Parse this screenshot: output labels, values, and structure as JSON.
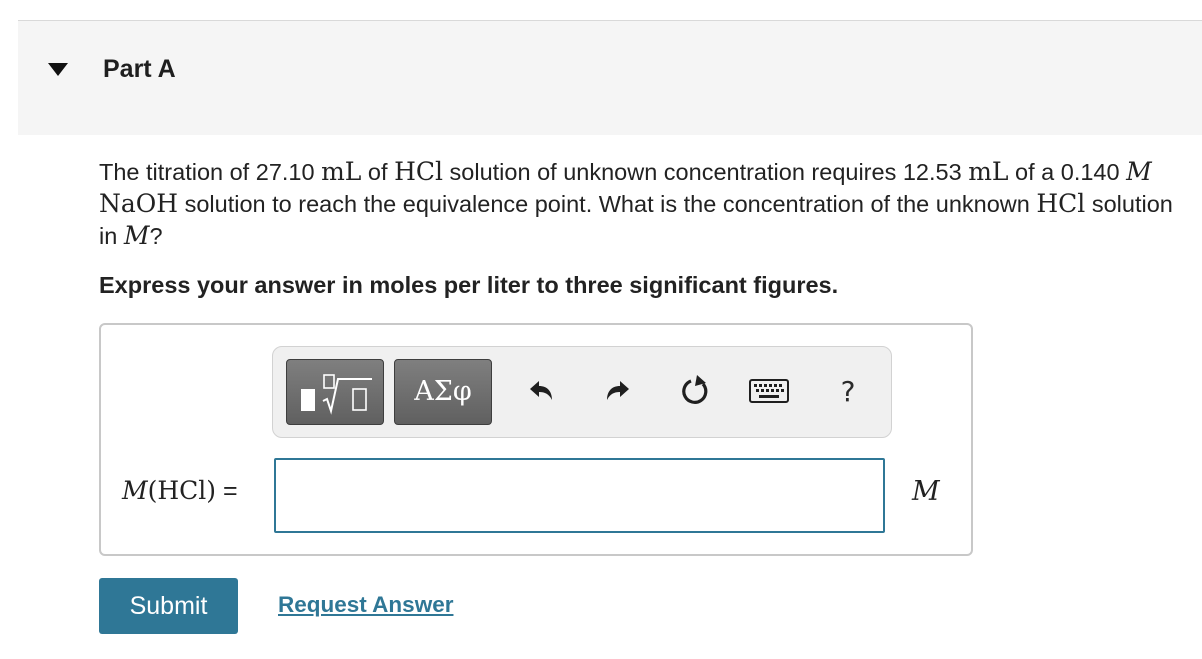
{
  "part": {
    "title": "Part A",
    "toggle_icon": "caret-down-icon"
  },
  "question": {
    "t1": "The titration of 27.10 ",
    "v1": "mL",
    "t2": " of ",
    "v2": "HCl",
    "t3": " solution of unknown concentration requires 12.53 ",
    "v3": "mL",
    "t4": " of a 0.140 ",
    "v4": "M",
    "t5": " ",
    "v5": "NaOH",
    "t6": " solution to reach the equivalence point. What is the concentration of the unknown ",
    "v6": "HCl",
    "t7": " solution in ",
    "v7": "M",
    "t8": "?"
  },
  "instruction": "Express your answer in moles per liter to three significant figures.",
  "toolbar": {
    "templates_icon": "templates-sqrt-icon",
    "symbols_label": "ΑΣφ",
    "undo_icon": "undo-icon",
    "redo_icon": "redo-icon",
    "reset_icon": "reset-icon",
    "keyboard_icon": "keyboard-icon",
    "help_label": "?"
  },
  "answer": {
    "label_var": "M",
    "label_rest": "(HCl)",
    "equals": " =",
    "value": "",
    "unit": "M"
  },
  "actions": {
    "submit_label": "Submit",
    "request_label": "Request Answer"
  },
  "colors": {
    "accent": "#2f7796",
    "header_bg": "#f5f5f5",
    "button_gray": "#6f6f6f"
  }
}
